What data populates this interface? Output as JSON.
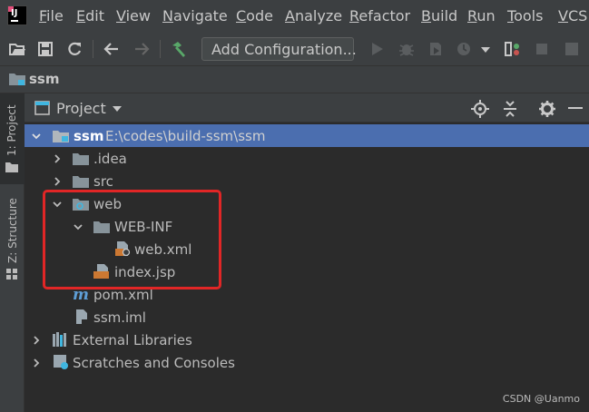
{
  "menu": [
    "File",
    "Edit",
    "View",
    "Navigate",
    "Code",
    "Analyze",
    "Refactor",
    "Build",
    "Run",
    "Tools",
    "VCS"
  ],
  "toolbar": {
    "add_configuration": "Add Configuration..."
  },
  "breadcrumb": {
    "project": "ssm"
  },
  "stripe": {
    "project_tab": "1: Project",
    "structure_tab": "Z: Structure"
  },
  "panel": {
    "title": "Project"
  },
  "tree": {
    "root_name": "ssm",
    "root_path": "E:\\codes\\build-ssm\\ssm",
    "idea": ".idea",
    "src": "src",
    "web": "web",
    "web_inf": "WEB-INF",
    "web_xml": "web.xml",
    "index_jsp": "index.jsp",
    "pom": "pom.xml",
    "iml": "ssm.iml",
    "external_libraries": "External Libraries",
    "scratches": "Scratches and Consoles"
  },
  "watermark": "CSDN @Uanmo",
  "colors": {
    "selection": "#4b6eaf",
    "highlight_box": "#e12626",
    "folder": "#87939a",
    "build_green": "#59a869"
  }
}
